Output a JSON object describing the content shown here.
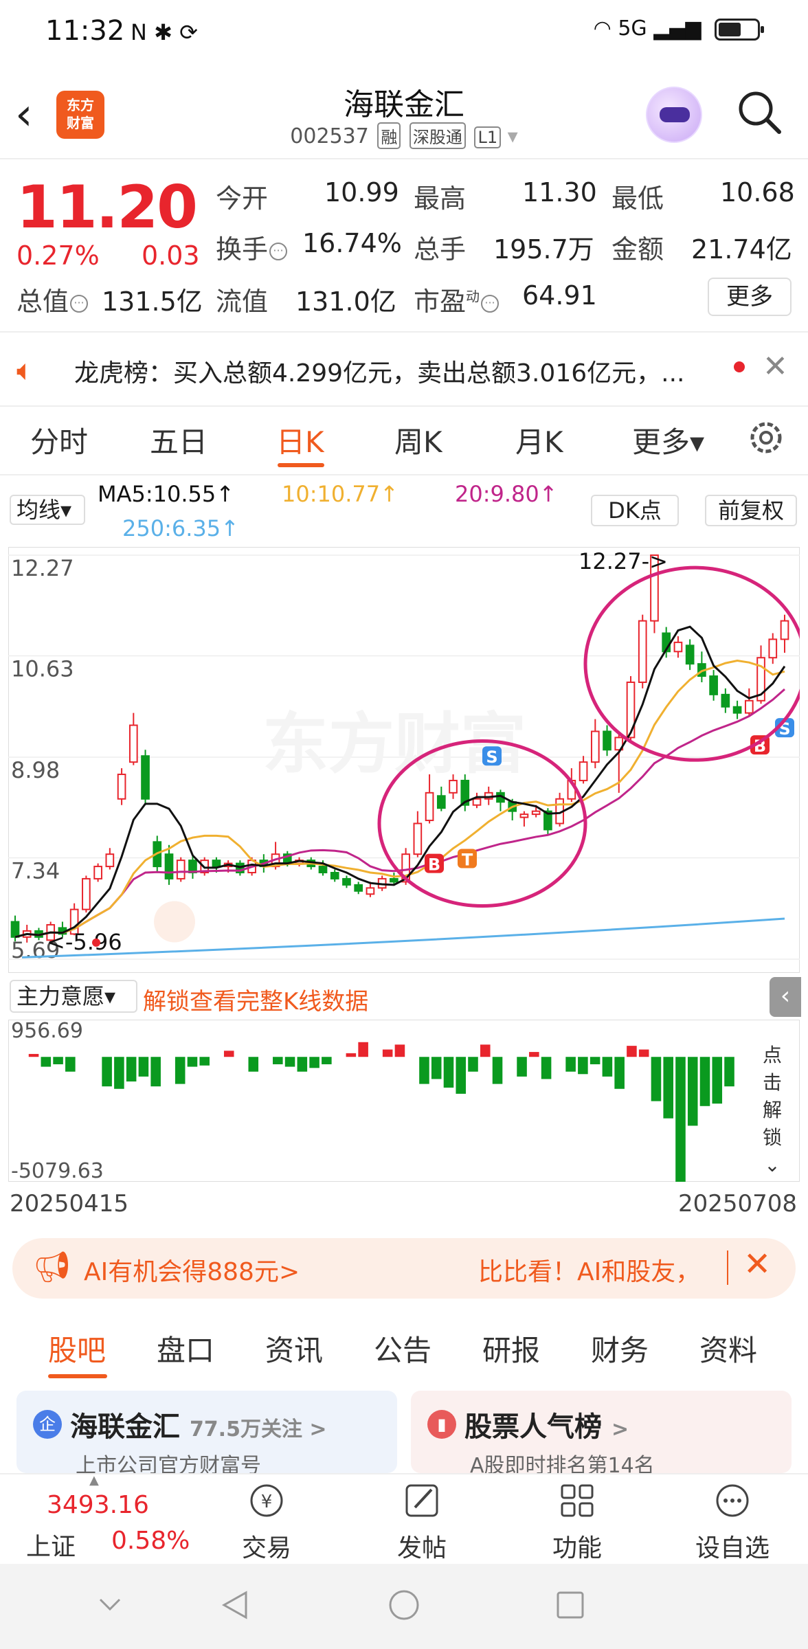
{
  "status_bar": {
    "time": "11:32",
    "left_icons": "N ✱ ⟳",
    "right_icons": "5G"
  },
  "header": {
    "logo_text": "东方\n财富",
    "stock_name": "海联金汇",
    "stock_code": "002537",
    "tags": [
      "融",
      "深股通",
      "L1"
    ]
  },
  "quote": {
    "price": "11.20",
    "change_pct": "0.27%",
    "change_amt": "0.03",
    "open_label": "今开",
    "open": "10.99",
    "high_label": "最高",
    "high": "11.30",
    "low_label": "最低",
    "low": "10.68",
    "turnover_label": "换手",
    "turnover": "16.74%",
    "volume_label": "总手",
    "volume": "195.7万",
    "amount_label": "金额",
    "amount": "21.74亿",
    "mcap_label": "总值",
    "mcap": "131.5亿",
    "float_label": "流值",
    "float": "131.0亿",
    "pe_label": "市盈",
    "pe_sup": "动",
    "pe": "64.91",
    "more_label": "更多"
  },
  "notice": {
    "text": "龙虎榜：买入总额4.299亿元，卖出总额3.016亿元，..."
  },
  "tabs": [
    "分时",
    "五日",
    "日K",
    "周K",
    "月K",
    "更多▾"
  ],
  "active_tab": "日K",
  "ma_bar": {
    "selector": "均线▾",
    "ma5": "MA5:10.55↑",
    "ma10": "10:10.77↑",
    "ma20": "20:9.80↑",
    "ma250": "250:6.35↑",
    "dk_button": "DK点",
    "adjust_button": "前复权"
  },
  "colors": {
    "up": "#e8252d",
    "down": "#0a9a1f",
    "ma5": "#111111",
    "ma10": "#f0b030",
    "ma20": "#c0258a",
    "ma250": "#5ab0e8",
    "accent": "#f05a1e",
    "circle": "#d6247a"
  },
  "chart_data": [
    {
      "type": "candlestick",
      "title": "",
      "y_ticks": [
        "12.27",
        "10.63",
        "8.98",
        "7.34",
        "5.69"
      ],
      "ylim": [
        5.69,
        12.27
      ],
      "annotations": {
        "max_label": "12.27->",
        "min_label": "<-5.96"
      },
      "watermark": "东方财富",
      "candles": [
        [
          6.3,
          6.05,
          6.4,
          5.98
        ],
        [
          6.05,
          6.15,
          6.25,
          5.96
        ],
        [
          6.15,
          6.05,
          6.2,
          6.0
        ],
        [
          6.0,
          6.25,
          6.3,
          5.98
        ],
        [
          6.2,
          6.1,
          6.3,
          6.05
        ],
        [
          6.1,
          6.5,
          6.6,
          6.08
        ],
        [
          6.5,
          7.0,
          7.05,
          6.45
        ],
        [
          7.0,
          7.2,
          7.25,
          6.95
        ],
        [
          7.2,
          7.4,
          7.5,
          7.15
        ],
        [
          8.3,
          8.7,
          8.8,
          8.2
        ],
        [
          8.9,
          9.5,
          9.7,
          8.85
        ],
        [
          9.0,
          8.3,
          9.1,
          8.2
        ],
        [
          7.6,
          7.2,
          7.7,
          7.1
        ],
        [
          7.4,
          7.0,
          7.55,
          6.9
        ],
        [
          7.0,
          7.3,
          7.35,
          6.95
        ],
        [
          7.3,
          7.1,
          7.4,
          7.0
        ],
        [
          7.1,
          7.3,
          7.35,
          7.05
        ],
        [
          7.3,
          7.2,
          7.35,
          7.1
        ],
        [
          7.2,
          7.25,
          7.3,
          7.1
        ],
        [
          7.25,
          7.1,
          7.3,
          7.05
        ],
        [
          7.1,
          7.3,
          7.35,
          7.05
        ],
        [
          7.3,
          7.2,
          7.4,
          7.1
        ],
        [
          7.2,
          7.4,
          7.6,
          7.15
        ],
        [
          7.4,
          7.25,
          7.45,
          7.2
        ],
        [
          7.25,
          7.3,
          7.35,
          7.2
        ],
        [
          7.3,
          7.2,
          7.35,
          7.15
        ],
        [
          7.2,
          7.1,
          7.3,
          7.05
        ],
        [
          7.1,
          7.0,
          7.15,
          6.95
        ],
        [
          7.0,
          6.9,
          7.05,
          6.85
        ],
        [
          6.9,
          6.8,
          6.95,
          6.75
        ],
        [
          6.75,
          6.85,
          6.95,
          6.7
        ],
        [
          6.85,
          7.0,
          7.05,
          6.8
        ],
        [
          7.0,
          6.95,
          7.1,
          6.9
        ],
        [
          6.95,
          7.4,
          7.5,
          6.9
        ],
        [
          7.4,
          7.9,
          8.1,
          7.35
        ],
        [
          7.95,
          8.4,
          8.7,
          7.9
        ],
        [
          8.35,
          8.15,
          8.5,
          8.1
        ],
        [
          8.4,
          8.6,
          8.7,
          8.3
        ],
        [
          8.6,
          8.2,
          8.7,
          8.1
        ],
        [
          8.2,
          8.3,
          8.4,
          8.15
        ],
        [
          8.3,
          8.4,
          8.5,
          8.2
        ],
        [
          8.4,
          8.25,
          8.45,
          8.1
        ],
        [
          8.25,
          8.1,
          8.3,
          7.95
        ],
        [
          8.0,
          8.05,
          8.1,
          7.85
        ],
        [
          8.05,
          8.1,
          8.2,
          8.0
        ],
        [
          8.1,
          7.8,
          8.15,
          7.7
        ],
        [
          7.9,
          8.3,
          8.4,
          7.85
        ],
        [
          8.3,
          8.6,
          8.8,
          8.25
        ],
        [
          8.6,
          8.9,
          9.0,
          8.55
        ],
        [
          8.9,
          9.4,
          9.6,
          8.8
        ],
        [
          9.4,
          9.1,
          9.5,
          9.0
        ],
        [
          9.1,
          9.3,
          9.4,
          8.4
        ],
        [
          9.3,
          10.2,
          10.3,
          9.25
        ],
        [
          10.2,
          11.2,
          11.3,
          10.1
        ],
        [
          11.2,
          12.27,
          12.27,
          11.0
        ],
        [
          11.0,
          10.7,
          11.1,
          10.6
        ],
        [
          10.7,
          10.85,
          10.95,
          10.6
        ],
        [
          10.8,
          10.5,
          10.9,
          10.4
        ],
        [
          10.5,
          10.3,
          10.7,
          10.2
        ],
        [
          10.3,
          10.0,
          10.4,
          9.9
        ],
        [
          10.0,
          9.8,
          10.1,
          9.7
        ],
        [
          9.8,
          9.7,
          9.9,
          9.6
        ],
        [
          9.7,
          9.9,
          10.1,
          9.65
        ],
        [
          9.9,
          10.6,
          10.8,
          9.85
        ],
        [
          10.6,
          10.9,
          11.0,
          10.5
        ],
        [
          10.9,
          11.2,
          11.3,
          10.68
        ]
      ],
      "trade_markers": [
        "B",
        "T",
        "S",
        "B",
        "S"
      ]
    },
    {
      "type": "bar",
      "title": "主力意愿",
      "y_ticks": [
        "956.69",
        "-5079.63"
      ],
      "ylim": [
        -5079.63,
        956.69
      ],
      "x_ticks": [
        "20250415",
        "20250708"
      ],
      "values": [
        0,
        120,
        -400,
        -300,
        -600,
        0,
        0,
        -1200,
        -1300,
        -1000,
        -800,
        -1200,
        0,
        -1100,
        -400,
        -350,
        0,
        250,
        0,
        -600,
        0,
        -300,
        -400,
        -600,
        -450,
        -300,
        0,
        150,
        600,
        0,
        300,
        500,
        0,
        -1100,
        -900,
        -1250,
        -1500,
        -600,
        500,
        -1100,
        0,
        -800,
        200,
        -900,
        0,
        -600,
        -700,
        -300,
        -800,
        -1300,
        450,
        300,
        -1800,
        -2500,
        -5079.63,
        -2800,
        -2000,
        -1900,
        -1200
      ]
    }
  ],
  "flow_selector": "主力意愿▾",
  "unlock_link": "解锁查看完整K线数据",
  "side_unlock": "点击解锁",
  "banner": {
    "left": "AI有机会得888元>",
    "right": "比比看！AI和股友，"
  },
  "bottom_tabs": [
    "股吧",
    "盘口",
    "资讯",
    "公告",
    "研报",
    "财务",
    "资料"
  ],
  "cards": [
    {
      "icon": "企",
      "title": "海联金汇",
      "sub": "77.5万关注 >",
      "line2": "上市公司官方财富号"
    },
    {
      "icon": "▮",
      "title": "股票人气榜",
      "sub": ">",
      "line2": "A股即时排名第14名"
    }
  ],
  "bottom_nav": {
    "index_value": "3493.16",
    "index_name": "上证",
    "index_pct": "0.58%",
    "items": [
      "交易",
      "发帖",
      "功能",
      "设自选"
    ]
  }
}
